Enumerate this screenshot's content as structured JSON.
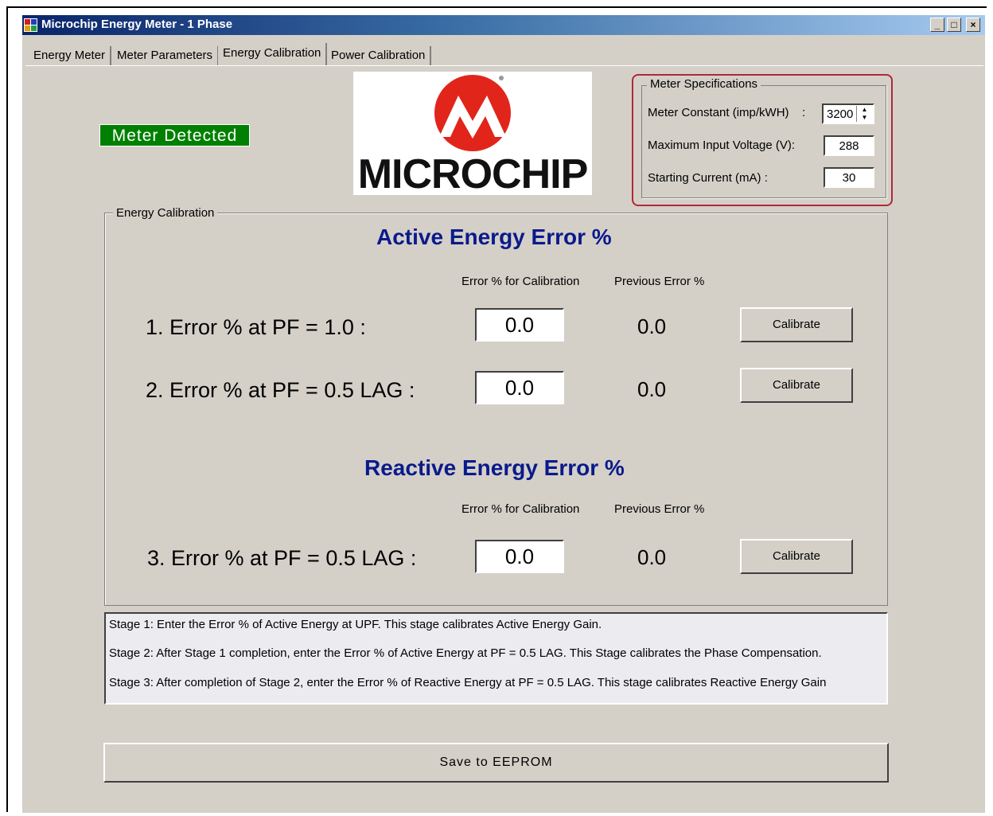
{
  "window": {
    "title": "Microchip Energy Meter - 1 Phase",
    "controls": {
      "minimize": "_",
      "maximize": "□",
      "close": "×"
    }
  },
  "tabs": [
    {
      "label": "Energy Meter"
    },
    {
      "label": "Meter Parameters"
    },
    {
      "label": "Energy Calibration",
      "active": true
    },
    {
      "label": "Power Calibration"
    }
  ],
  "status": {
    "badge": "Meter Detected",
    "color": "#008000"
  },
  "logo": {
    "text": "MICROCHIP",
    "color": "#e1251b"
  },
  "meter_specs": {
    "legend": "Meter Specifications",
    "meter_constant_label": "Meter Constant (imp/kWH)",
    "colon": ":",
    "meter_constant_value": "3200",
    "max_voltage_label": "Maximum Input Voltage (V):",
    "max_voltage_value": "288",
    "starting_current_label": "Starting Current (mA) :",
    "starting_current_value": "30"
  },
  "energy_calibration": {
    "legend": "Energy Calibration",
    "active": {
      "title": "Active Energy Error %",
      "col_error": "Error % for Calibration",
      "col_prev": "Previous Error %",
      "rows": [
        {
          "label": "1. Error % at PF = 1.0 :",
          "value": "0.0",
          "previous": "0.0",
          "button": "Calibrate"
        },
        {
          "label": "2. Error % at PF = 0.5 LAG :",
          "value": "0.0",
          "previous": "0.0",
          "button": "Calibrate"
        }
      ]
    },
    "reactive": {
      "title": "Reactive Energy Error %",
      "col_error": "Error % for Calibration",
      "col_prev": "Previous Error %",
      "rows": [
        {
          "label": "3. Error % at PF = 0.5 LAG :",
          "value": "0.0",
          "previous": "0.0",
          "button": "Calibrate"
        }
      ]
    }
  },
  "instructions": [
    "Stage 1: Enter the Error % of Active Energy at UPF. This stage calibrates Active Energy Gain.",
    "Stage 2: After Stage 1 completion, enter the Error % of Active Energy at PF = 0.5 LAG. This Stage calibrates the Phase Compensation.",
    "Stage 3: After completion of Stage 2, enter the Error % of Reactive Energy at PF = 0.5 LAG. This stage calibrates Reactive Energy Gain"
  ],
  "save_button": "Save to EEPROM",
  "colors": {
    "title_blue": "#0a1a8c",
    "window_bg": "#d4d0c8",
    "specs_border": "#b0283a"
  }
}
